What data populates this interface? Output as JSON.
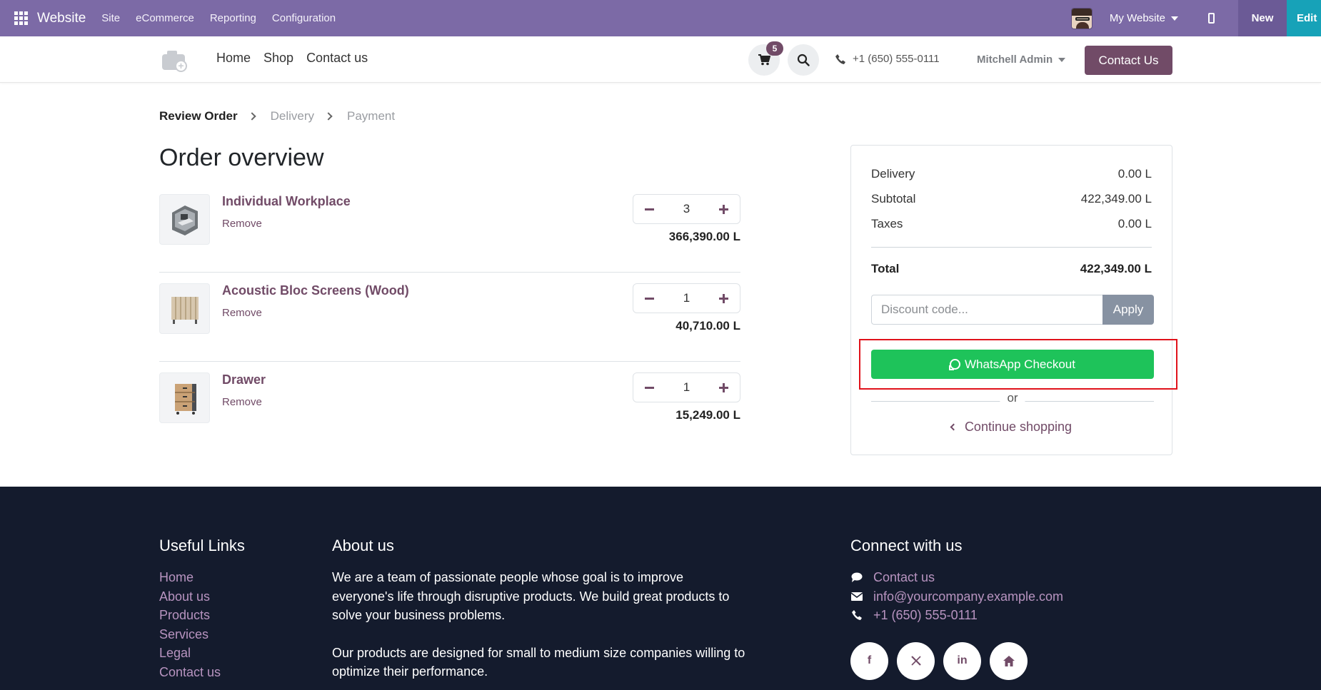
{
  "topbar": {
    "app_name": "Website",
    "menu": [
      "Site",
      "eCommerce",
      "Reporting",
      "Configuration"
    ],
    "website_selector": "My Website",
    "new_label": "New",
    "edit_label": "Edit",
    "bar_color": "#7c6aa6"
  },
  "header": {
    "nav": [
      "Home",
      "Shop",
      "Contact us"
    ],
    "cart_count": "5",
    "phone": "+1 (650) 555-0111",
    "user": "Mitchell Admin",
    "contact_button": "Contact Us",
    "brand_color": "#714b67"
  },
  "steps": {
    "active": "Review Order",
    "delivery": "Delivery",
    "payment": "Payment"
  },
  "page_title": "Order overview",
  "order_lines": [
    {
      "name": "Individual Workplace",
      "remove": "Remove",
      "qty": "3",
      "price": "366,390.00 L"
    },
    {
      "name": "Acoustic Bloc Screens (Wood)",
      "remove": "Remove",
      "qty": "1",
      "price": "40,710.00 L"
    },
    {
      "name": "Drawer",
      "remove": "Remove",
      "qty": "1",
      "price": "15,249.00 L"
    }
  ],
  "summary": {
    "delivery_label": "Delivery",
    "delivery_value": "0.00 L",
    "subtotal_label": "Subtotal",
    "subtotal_value": "422,349.00 L",
    "taxes_label": "Taxes",
    "taxes_value": "0.00 L",
    "total_label": "Total",
    "total_value": "422,349.00 L",
    "discount_placeholder": "Discount code...",
    "apply_label": "Apply",
    "whatsapp_label": "WhatsApp Checkout",
    "whatsapp_color": "#1ec35a",
    "or_label": "or",
    "continue_label": "Continue shopping"
  },
  "footer": {
    "links_heading": "Useful Links",
    "links": [
      "Home",
      "About us",
      "Products",
      "Services",
      "Legal",
      "Contact us"
    ],
    "about_heading": "About us",
    "about_text_1": "We are a team of passionate people whose goal is to improve everyone's life through disruptive products. We build great products to solve your business problems.",
    "about_text_2": "Our products are designed for small to medium size companies willing to optimize their performance.",
    "connect_heading": "Connect with us",
    "contact_link": "Contact us",
    "email": "info@yourcompany.example.com",
    "phone": "+1 (650) 555-0111",
    "social_icons": [
      "facebook-icon",
      "x-icon",
      "linkedin-icon",
      "home-icon"
    ],
    "background": "#141b2d"
  }
}
